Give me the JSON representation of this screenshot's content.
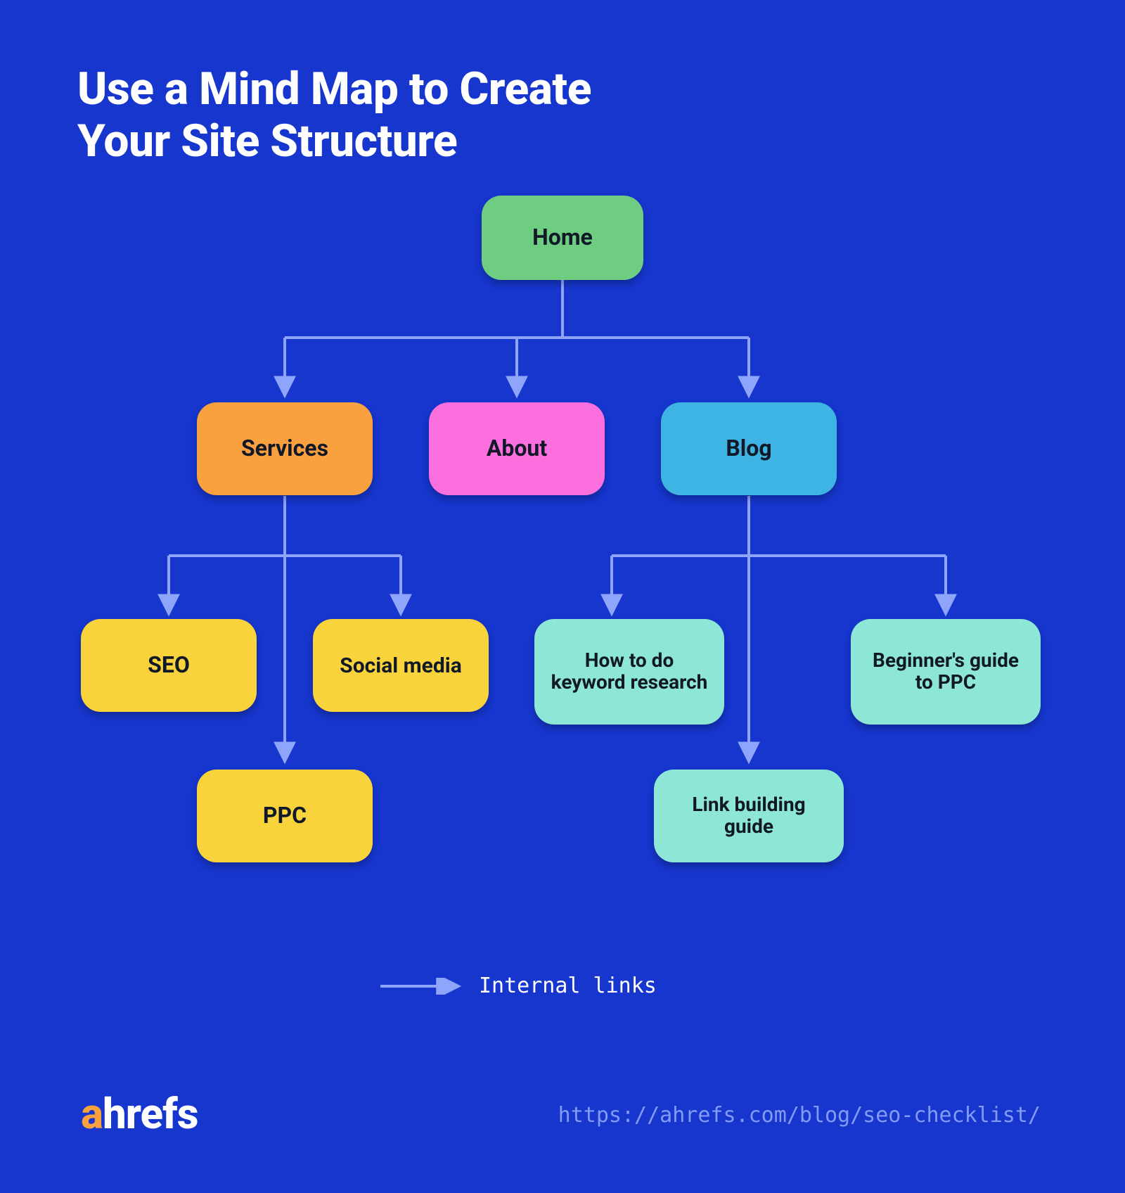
{
  "title": "Use a Mind Map to Create\nYour Site Structure",
  "nodes": {
    "home": "Home",
    "services": "Services",
    "about": "About",
    "blog": "Blog",
    "seo": "SEO",
    "social": "Social media",
    "ppc": "PPC",
    "howto": "How to do keyword research",
    "beginner": "Beginner's guide to PPC",
    "linkbuild": "Link building guide"
  },
  "legend": {
    "label": "Internal links"
  },
  "logo": {
    "a": "a",
    "rest": "hrefs"
  },
  "url": "https://ahrefs.com/blog/seo-checklist/",
  "colors": {
    "bg": "#1636CE",
    "home": "#6FCD82",
    "services": "#F9A03F",
    "about": "#FB6FDE",
    "blog": "#3EB4E4",
    "leaf_services": "#F9D33C",
    "leaf_blog": "#8EE6D6",
    "connector": "#8FA5FB"
  },
  "diagram": {
    "type": "tree",
    "root": "Home",
    "children": [
      {
        "label": "Services",
        "children": [
          "SEO",
          "Social media",
          "PPC"
        ]
      },
      {
        "label": "About",
        "children": []
      },
      {
        "label": "Blog",
        "children": [
          "How to do keyword research",
          "Link building guide",
          "Beginner's guide to PPC"
        ]
      }
    ]
  }
}
